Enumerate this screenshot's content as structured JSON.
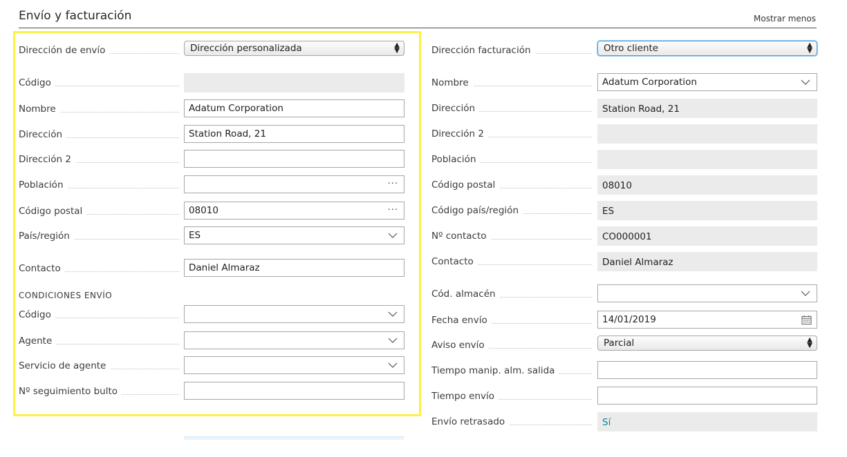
{
  "section": {
    "title": "Envío y facturación",
    "show_less_label": "Mostrar menos"
  },
  "shipping": {
    "ship_to": {
      "label": "Dirección de envío",
      "value": "Dirección personalizada"
    },
    "code": {
      "label": "Código",
      "value": ""
    },
    "name": {
      "label": "Nombre",
      "value": "Adatum Corporation"
    },
    "address": {
      "label": "Dirección",
      "value": "Station Road, 21"
    },
    "address2": {
      "label": "Dirección 2",
      "value": ""
    },
    "city": {
      "label": "Población",
      "value": ""
    },
    "post_code": {
      "label": "Código postal",
      "value": "08010"
    },
    "country": {
      "label": "País/región",
      "value": "ES"
    },
    "contact": {
      "label": "Contacto",
      "value": "Daniel Almaraz"
    },
    "conditions_heading": "CONDICIONES ENVÍO",
    "cond_code": {
      "label": "Código",
      "value": ""
    },
    "agent": {
      "label": "Agente",
      "value": ""
    },
    "agent_service": {
      "label": "Servicio de agente",
      "value": ""
    },
    "tracking": {
      "label": "Nº seguimiento bulto",
      "value": ""
    }
  },
  "billing": {
    "bill_to": {
      "label": "Dirección facturación",
      "value": "Otro cliente"
    },
    "name": {
      "label": "Nombre",
      "value": "Adatum Corporation"
    },
    "address": {
      "label": "Dirección",
      "value": "Station Road, 21"
    },
    "address2": {
      "label": "Dirección 2",
      "value": ""
    },
    "city": {
      "label": "Población",
      "value": ""
    },
    "post_code": {
      "label": "Código postal",
      "value": "08010"
    },
    "country_code": {
      "label": "Código país/región",
      "value": "ES"
    },
    "contact_no": {
      "label": "Nº contacto",
      "value": "CO000001"
    },
    "contact": {
      "label": "Contacto",
      "value": "Daniel Almaraz"
    },
    "location": {
      "label": "Cód. almacén",
      "value": ""
    },
    "ship_date": {
      "label": "Fecha envío",
      "value": "14/01/2019"
    },
    "ship_advice": {
      "label": "Aviso envío",
      "value": "Parcial"
    },
    "handling_time": {
      "label": "Tiempo manip. alm. salida",
      "value": ""
    },
    "shipping_time": {
      "label": "Tiempo envío",
      "value": ""
    },
    "late": {
      "label": "Envío retrasado",
      "value": "Sí"
    }
  },
  "icons": {
    "dropdown": "chevron-down-icon",
    "lookup": "ellipsis-icon",
    "select": "updown-arrows-icon",
    "date": "calendar-icon"
  }
}
